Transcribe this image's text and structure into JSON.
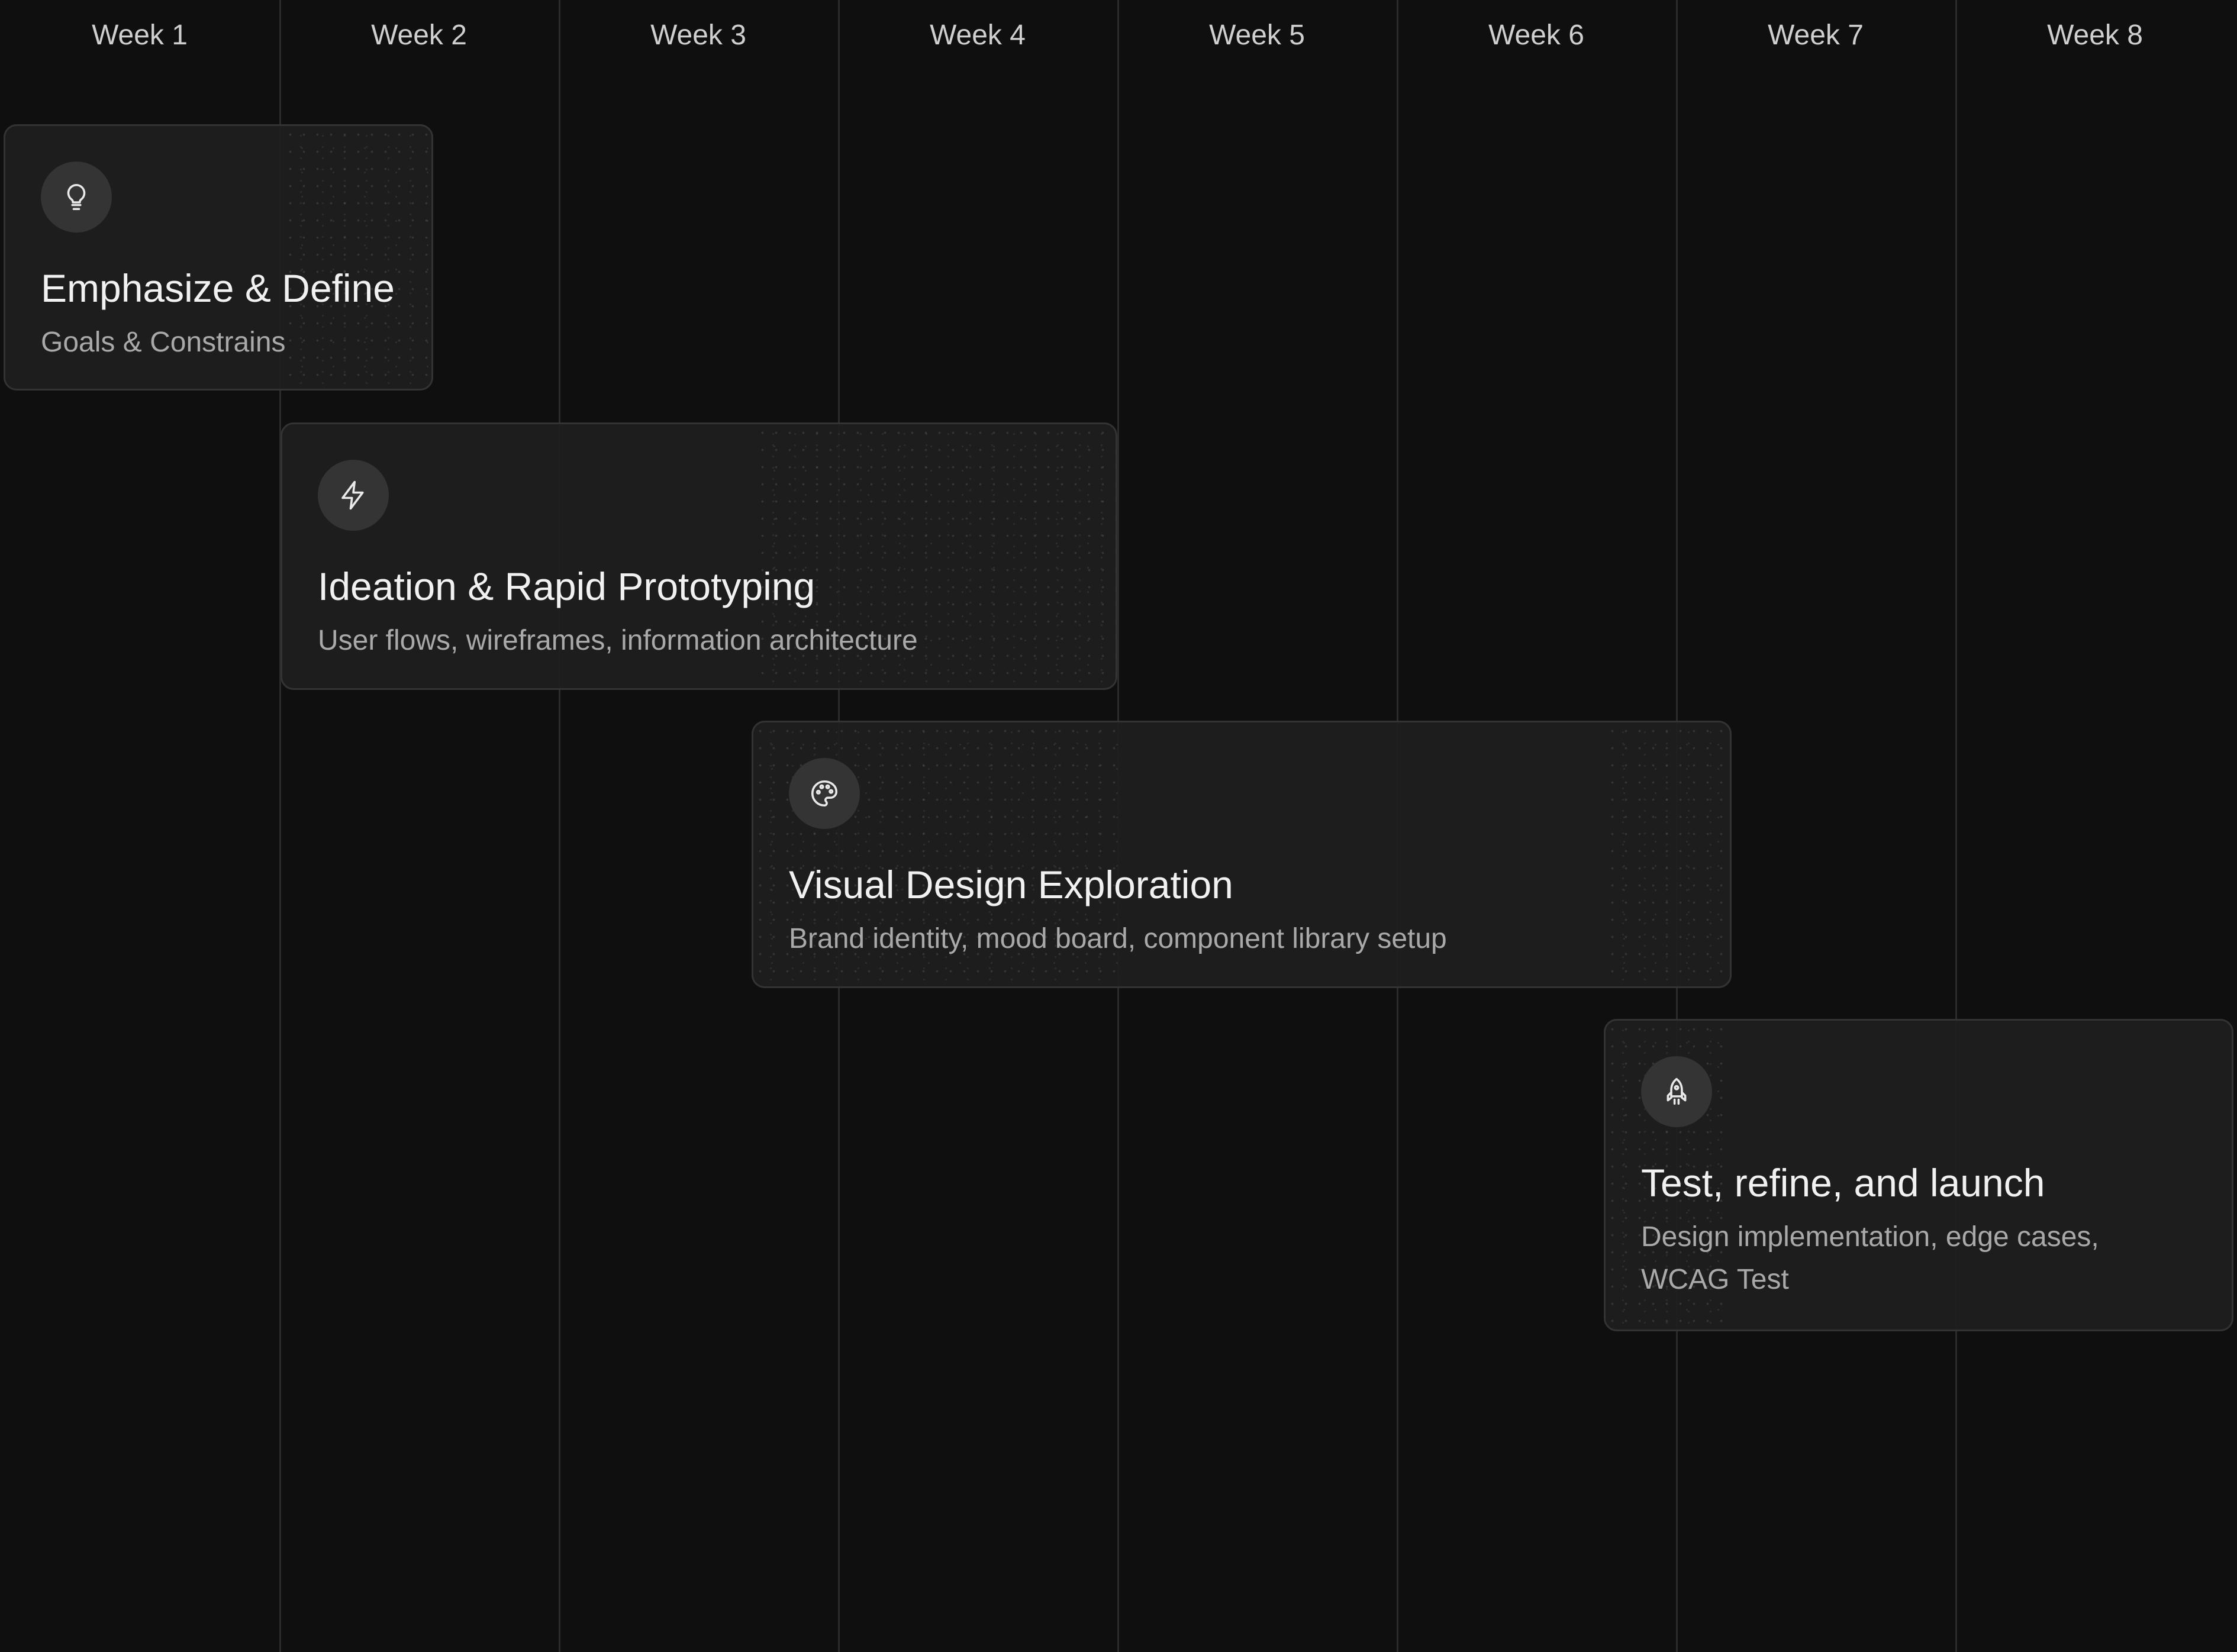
{
  "timeline": {
    "weeks": [
      "Week 1",
      "Week 2",
      "Week 3",
      "Week 4",
      "Week 5",
      "Week 6",
      "Week 7",
      "Week 8"
    ]
  },
  "phases": [
    {
      "title": "Emphasize & Define",
      "description": "Goals & Constrains",
      "icon": "lightbulb-icon"
    },
    {
      "title": "Ideation & Rapid Prototyping",
      "description": "User flows, wireframes, information architecture",
      "icon": "lightning-bolt-icon"
    },
    {
      "title": "Visual Design Exploration",
      "description": "Brand identity, mood board, component library setup",
      "icon": "palette-icon"
    },
    {
      "title": "Test, refine, and launch",
      "description": "Design implementation, edge cases, WCAG Test",
      "icon": "rocket-icon"
    }
  ],
  "colors": {
    "background": "#0f0f0f",
    "card_background": "#1e1e1e",
    "card_border": "#333333",
    "icon_badge": "#343434",
    "grid_line": "#2b2b2b",
    "title_text": "#f1f1f1",
    "description_text": "#a9a9a9",
    "week_label_text": "#cfcfcf"
  }
}
